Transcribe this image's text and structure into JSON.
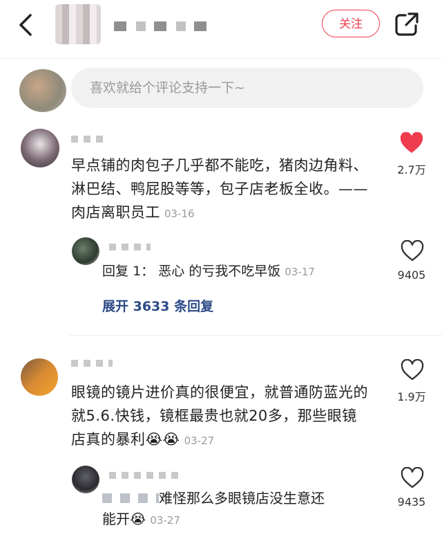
{
  "header": {
    "follow_label": "关注"
  },
  "comment_bar": {
    "placeholder": "喜欢就给个评论支持一下~"
  },
  "comments": [
    {
      "text": "早点铺的肉包子几乎都不能吃，猪肉边角料、淋巴结、鸭屁股等等，包子店老板全收。——肉店离职员工",
      "date": "03-16",
      "likes": "2.7万",
      "liked": true,
      "reply": {
        "prefix": "回复",
        "reply_to": "1：",
        "text": "恶心 的亏我不吃早饭",
        "date": "03-17",
        "likes": "9405"
      },
      "expand_label": "展开 3633 条回复"
    },
    {
      "text": "眼镜的镜片进价真的很便宜，就普通防蓝光的就5.6.快钱，镜框最贵也就20多，那些眼镜店真的暴利",
      "emoji": "😭😭",
      "date": "03-27",
      "likes": "1.9万",
      "liked": false,
      "reply": {
        "text": "难怪那么多眼镜店没生意还",
        "text_cont": "能开",
        "emoji": "😭",
        "date": "03-27",
        "likes": "9435"
      }
    }
  ],
  "colors": {
    "accent": "#ef3b4e",
    "link": "#2c4a86",
    "muted": "#9a9a9a"
  },
  "icons": [
    "back-icon",
    "share-icon",
    "heart-filled-icon",
    "heart-outline-icon"
  ]
}
